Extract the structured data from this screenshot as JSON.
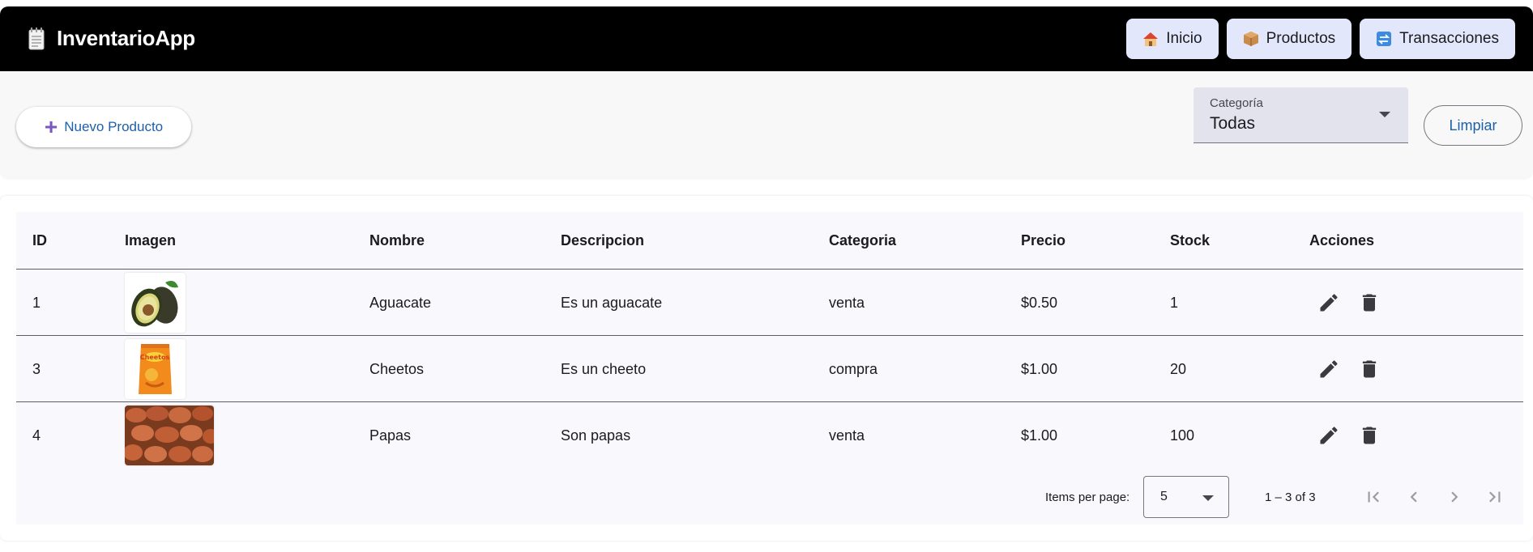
{
  "app": {
    "title": "InventarioApp",
    "brand_icon": "notepad-icon"
  },
  "nav": [
    {
      "label": "Inicio",
      "icon": "house-icon"
    },
    {
      "label": "Productos",
      "icon": "package-icon"
    },
    {
      "label": "Transacciones",
      "icon": "transactions-icon"
    }
  ],
  "toolbar": {
    "new_label": "Nuevo Producto",
    "new_icon": "plus-icon",
    "category_label": "Categoría",
    "category_value": "Todas",
    "clear_label": "Limpiar"
  },
  "table": {
    "columns": [
      "ID",
      "Imagen",
      "Nombre",
      "Descripcion",
      "Categoria",
      "Precio",
      "Stock",
      "Acciones"
    ],
    "rows": [
      {
        "id": "1",
        "image": "avocado",
        "name": "Aguacate",
        "description": "Es un aguacate",
        "category": "venta",
        "price": "$0.50",
        "stock": "1"
      },
      {
        "id": "3",
        "image": "cheetos",
        "name": "Cheetos",
        "description": "Es un cheeto",
        "category": "compra",
        "price": "$1.00",
        "stock": "20"
      },
      {
        "id": "4",
        "image": "potatoes",
        "name": "Papas",
        "description": "Son papas",
        "category": "venta",
        "price": "$1.00",
        "stock": "100"
      }
    ]
  },
  "paginator": {
    "items_per_page_label": "Items per page:",
    "page_size": "5",
    "range_label": "1 – 3 of 3"
  },
  "colors": {
    "navbar": "#000000",
    "nav_button": "#e3e7fb",
    "primary_text": "#1d5fa8",
    "table_bg": "#f9f9fd"
  }
}
